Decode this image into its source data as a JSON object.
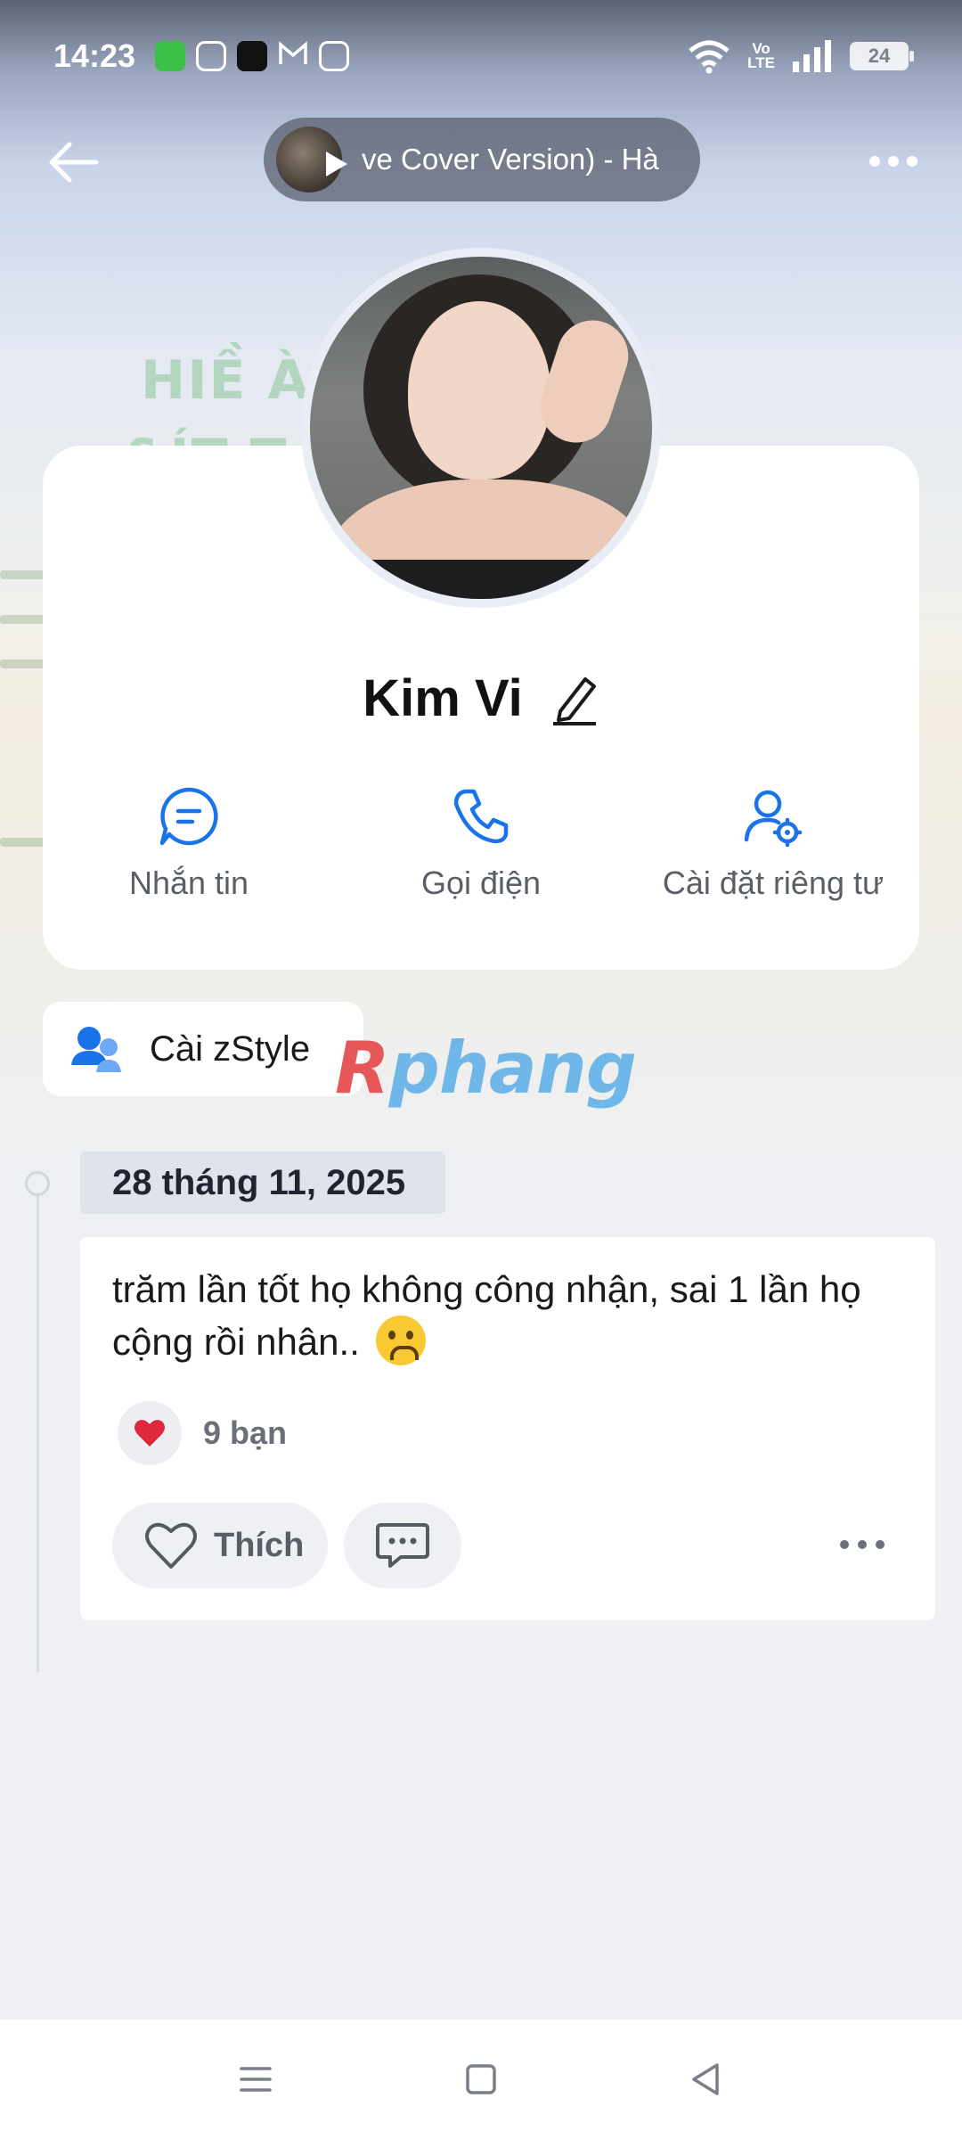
{
  "status_bar": {
    "time": "14:23",
    "network_label": "Vo\nLTE",
    "battery": "24",
    "app_icons": [
      "messages-icon",
      "instagram-icon",
      "tiktok-icon",
      "gmail-icon",
      "video-icon"
    ]
  },
  "top_nav": {
    "music_title": "ve Cover Version) - Hà"
  },
  "cover": {
    "ghost_line1": "HIỀ                 ÀI",
    "ghost_line2": "&ÍT T                  TIỀN"
  },
  "profile": {
    "name": "Kim Vi",
    "actions": [
      {
        "label": "Nhắn tin",
        "icon": "message-icon"
      },
      {
        "label": "Gọi điện",
        "icon": "phone-icon"
      },
      {
        "label": "Cài đặt riêng tư",
        "icon": "user-settings-icon"
      }
    ]
  },
  "zstyle": {
    "label": "Cài zStyle"
  },
  "watermark": {
    "first": "R",
    "rest": "phang"
  },
  "timeline": {
    "date": "28 tháng 11, 2025"
  },
  "post": {
    "text": "trăm lần tốt họ không công nhận, sai 1 lần họ cộng rồi nhân..",
    "reaction_count": "9 bạn",
    "like_label": "Thích"
  },
  "colors": {
    "accent": "#1877f2",
    "heart": "#e0283c",
    "card": "#ffffff",
    "page_bg": "#eef0f4"
  }
}
